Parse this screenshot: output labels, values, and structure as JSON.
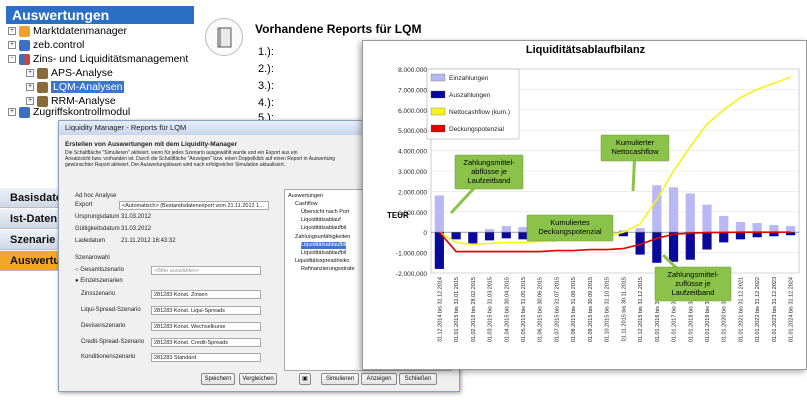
{
  "tree": {
    "header": "Auswertungen",
    "items": [
      {
        "label": "Marktdatenmanager",
        "expander": "+"
      },
      {
        "label": "zeb.control",
        "expander": "+"
      },
      {
        "label": "Zins- und Liquiditätsmanagement",
        "expander": "-"
      },
      {
        "label": "APS-Analyse",
        "expander": "+"
      },
      {
        "label": "LQM-Analysen",
        "expander": "+"
      },
      {
        "label": "RRM-Analyse",
        "expander": "+"
      },
      {
        "label": "Zugriffskontrollmodul",
        "expander": "+"
      }
    ]
  },
  "nav": [
    "Basisdate",
    "Ist-Daten",
    "Szenarie",
    "Auswertu"
  ],
  "reports": {
    "title": "Vorhandene Reports für LQM",
    "numbers": [
      "1.):",
      "2.):",
      "3.):",
      "4.):",
      "5.):"
    ]
  },
  "dialog": {
    "title": "Liquidity Manager - Reports für LQM",
    "heading": "Erstellen von Auswertungen mit dem Liquidity-Manager",
    "desc": [
      "Die Schaltfläche \"Simulieren\" aktiviert, wenn für jedes Szenario ausgewählt wurde und ein Export aus ein",
      "Ansatzsicht bzw. vorhanden ist. Durch die Schaltfläche \"Anzeigen\" bzw. einen Doppelklick auf einen Report in Auswertung",
      "gewünschter Report aktiviert. Der Auswertungsbaum wird nach erfolgreicher Simulation aktualisiert."
    ],
    "adhoc": "Ad hoc Analyse",
    "fields": [
      {
        "label": "Export",
        "value": "<Automatisch> (Bestandsdatenexport vom 21.11.2012 1..."
      },
      {
        "label": "Ursprungsdatum",
        "value": "31.03.2012"
      },
      {
        "label": "Gültigkeitsdatum",
        "value": "31.03.2012"
      },
      {
        "label": "Ladedatum",
        "value": "21.11.2012 16:43:32"
      }
    ],
    "szenario_label": "Szenarowahl",
    "radio1": "Gesamtszenario",
    "radio1_value": "<Bitte auswählen>",
    "radio2": "Einzelszenarien",
    "scen": [
      {
        "label": "Zinsszenario",
        "value": "281283 Konst. Zinsen"
      },
      {
        "label": "Liqui-Spread-Szenario",
        "value": "281283 Konst. Liqui-Spreads"
      },
      {
        "label": "Devisenszenario",
        "value": "281283 Konst. Wechselkurse"
      },
      {
        "label": "Credit-Spread-Szenario",
        "value": "281283 Konst. Credit-Spreads"
      },
      {
        "label": "Konditionenszenario",
        "value": "281283 Standard"
      }
    ],
    "tree": [
      "Auswertungen",
      "Cashflow",
      "Übersicht nach Port",
      "Liquiditätsablauf",
      "Liquiditätsablaufbil",
      "Zahlungsunfähigkeiten",
      "Liquiditätsablaufbil",
      "Liquiditätsablaufbil",
      "Liquiditätsspreadrisiko",
      "Refinanzierungsstrate"
    ],
    "buttons": {
      "save": "Speichern",
      "compare": "Vergleichen",
      "simulate": "Simulieren",
      "show": "Anzeigen",
      "close": "Schließen"
    }
  },
  "chart_data": {
    "type": "bar",
    "title": "Liquiditätsablaufbilanz",
    "ylabel": "TEUR",
    "ylim": [
      -2000000,
      8000000
    ],
    "yticks": [
      "8.000.000",
      "7.000.000",
      "6.000.000",
      "5.000.000",
      "4.000.000",
      "3.000.000",
      "2.000.000",
      "1.000.000",
      "0",
      "-1.000.000",
      "-2.000.000"
    ],
    "categories": [
      "31.12.2014 bis 31.12.2014",
      "01.01.2015 bis 31.01.2015",
      "01.02.2015 bis 28.02.2015",
      "01.03.2015 bis 31.03.2015",
      "01.04.2015 bis 30.04.2015",
      "01.05.2015 bis 31.05.2015",
      "01.06.2015 bis 30.06.2015",
      "01.07.2015 bis 31.07.2015",
      "01.08.2015 bis 31.08.2015",
      "01.09.2015 bis 30.09.2015",
      "01.10.2015 bis 31.10.2015",
      "01.11.2015 bis 30.11.2015",
      "01.12.2015 bis 31.12.2015",
      "01.01.2016 bis 31.12.2016",
      "01.01.2017 bis 31.12.2017",
      "01.01.2018 bis 31.12.2018",
      "01.01.2019 bis 31.12.2019",
      "01.01.2020 bis 31.12.2020",
      "01.01.2021 bis 31.12.2021",
      "01.01.2022 bis 31.12.2022",
      "01.01.2023 bis 31.12.2023",
      "01.01.2024 bis 31.12.2024"
    ],
    "series": [
      {
        "name": "Einzahlungen",
        "color": "#b8b8f4",
        "values": [
          1800000,
          0,
          -300000,
          150000,
          300000,
          250000,
          150000,
          100000,
          50000,
          100000,
          80000,
          100000,
          200000,
          2300000,
          2200000,
          1900000,
          1350000,
          800000,
          500000,
          450000,
          350000,
          300000
        ]
      },
      {
        "name": "Auszahlungen",
        "color": "#0a0a9a",
        "values": [
          -1800000,
          -350000,
          -550000,
          -400000,
          -300000,
          -350000,
          -300000,
          -300000,
          -200000,
          -250000,
          -200000,
          -200000,
          -1100000,
          -1500000,
          -1450000,
          -1350000,
          -850000,
          -500000,
          -350000,
          -250000,
          -200000,
          -150000
        ]
      },
      {
        "name": "Nettocashflow (kum.)",
        "color": "#f4f416",
        "values": [
          0,
          -500000,
          -600000,
          -550000,
          -500000,
          -500000,
          -450000,
          -400000,
          -350000,
          -250000,
          -200000,
          0,
          400000,
          1600000,
          3000000,
          4200000,
          5300000,
          6000000,
          6600000,
          7000000,
          7300000,
          7600000
        ]
      },
      {
        "name": "Deckungspotenzial",
        "color": "#e00000",
        "values": [
          0,
          -950000,
          -950000,
          -950000,
          -950000,
          -950000,
          -950000,
          -900000,
          -900000,
          -850000,
          -850000,
          -800000,
          -600000,
          -300000,
          -100000,
          -50000,
          -20000,
          -10000,
          0,
          0,
          0,
          0
        ]
      }
    ],
    "annotations": [
      {
        "text": [
          "Zahlungsmittel-",
          "abflüsse je",
          "Laufzeitband"
        ]
      },
      {
        "text": [
          "Kumulierter",
          "Nettocashflow"
        ]
      },
      {
        "text": [
          "Kumuliertes",
          "Deckungspotenzial"
        ]
      },
      {
        "text": [
          "Zahlungsmittel-",
          "zuflüsse je",
          "Laufzeitband"
        ]
      }
    ],
    "legend_position": "top-left",
    "grid": true
  }
}
